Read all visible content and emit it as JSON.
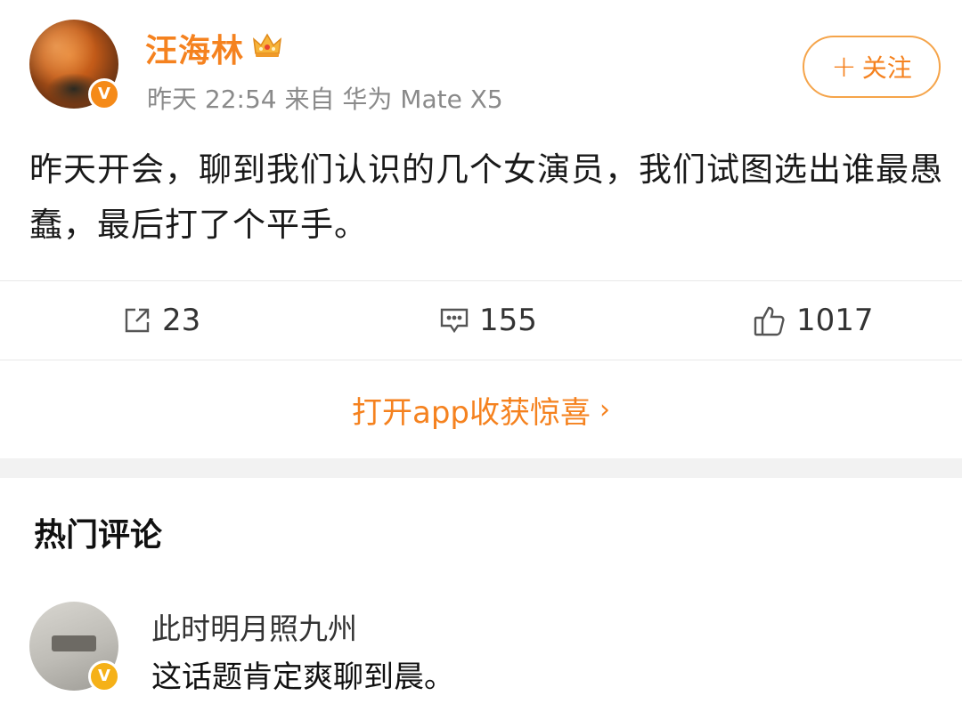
{
  "post": {
    "author": "汪海林",
    "meta": "昨天 22:54 来自 华为 Mate X5",
    "follow_label": "关注",
    "follow_plus": "+",
    "verified_mark": "V",
    "text": "昨天开会，聊到我们认识的几个女演员，我们试图选出谁最愚蠢，最后打了个平手。"
  },
  "actions": {
    "repost_count": "23",
    "comment_count": "155",
    "like_count": "1017"
  },
  "open_app": {
    "label": "打开app收获惊喜",
    "chevron": "›"
  },
  "hot_comments": {
    "title": "热门评论",
    "items": [
      {
        "user": "此时明月照九州",
        "text": "这话题肯定爽聊到晨。",
        "verified_mark": "V"
      }
    ]
  },
  "icons": {
    "crown": "crown-icon",
    "repost": "repost-icon",
    "comment": "comment-icon",
    "like": "thumbs-up-icon"
  },
  "colors": {
    "accent": "#f5821f",
    "meta_gray": "#8a8a8a",
    "badge_orange": "#f58a18"
  }
}
